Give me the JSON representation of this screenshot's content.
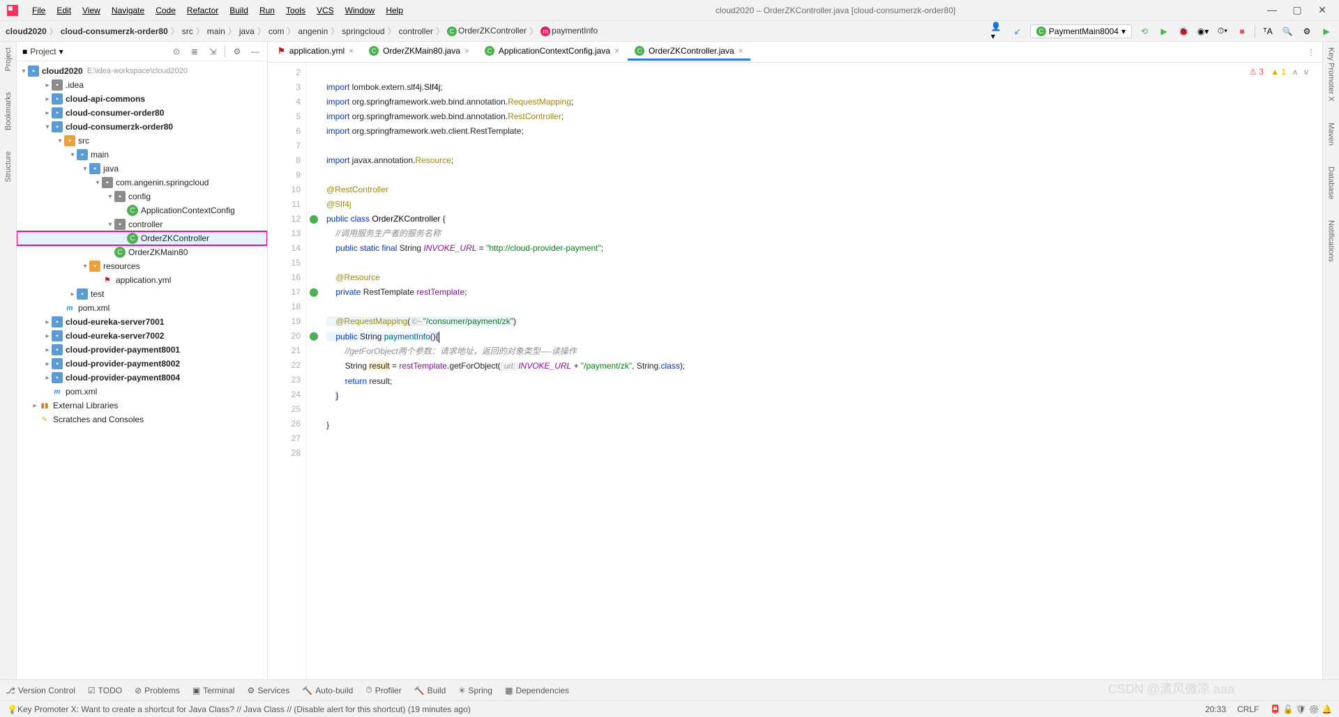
{
  "title": "cloud2020 – OrderZKController.java [cloud-consumerzk-order80]",
  "menu": [
    "File",
    "Edit",
    "View",
    "Navigate",
    "Code",
    "Refactor",
    "Build",
    "Run",
    "Tools",
    "VCS",
    "Window",
    "Help"
  ],
  "breadcrumb": {
    "parts": [
      "cloud2020",
      "cloud-consumerzk-order80",
      "src",
      "main",
      "java",
      "com",
      "angenin",
      "springcloud",
      "controller",
      "OrderZKController",
      "paymentInfo"
    ]
  },
  "run_config": "PaymentMain8004",
  "project_panel": {
    "title": "Project"
  },
  "tree": {
    "root": {
      "name": "cloud2020",
      "path": "E:\\idea-workspace\\cloud2020"
    },
    "items": [
      {
        "indent": 1,
        "name": ".idea",
        "type": "folder"
      },
      {
        "indent": 1,
        "name": "cloud-api-commons",
        "type": "folder-blue",
        "bold": true
      },
      {
        "indent": 1,
        "name": "cloud-consumer-order80",
        "type": "folder-blue",
        "bold": true
      },
      {
        "indent": 1,
        "name": "cloud-consumerzk-order80",
        "type": "folder-blue",
        "bold": true,
        "open": true
      },
      {
        "indent": 2,
        "name": "src",
        "type": "folder-src",
        "open": true
      },
      {
        "indent": 3,
        "name": "main",
        "type": "folder-blue",
        "open": true
      },
      {
        "indent": 4,
        "name": "java",
        "type": "folder-blue",
        "open": true
      },
      {
        "indent": 5,
        "name": "com.angenin.springcloud",
        "type": "folder",
        "open": true
      },
      {
        "indent": 6,
        "name": "config",
        "type": "folder",
        "open": true
      },
      {
        "indent": 7,
        "name": "ApplicationContextConfig",
        "type": "java"
      },
      {
        "indent": 6,
        "name": "controller",
        "type": "folder",
        "open": true
      },
      {
        "indent": 7,
        "name": "OrderZKController",
        "type": "java",
        "selected": true
      },
      {
        "indent": 6,
        "name": "OrderZKMain80",
        "type": "java"
      },
      {
        "indent": 4,
        "name": "resources",
        "type": "folder-src",
        "open": true
      },
      {
        "indent": 5,
        "name": "application.yml",
        "type": "yml"
      },
      {
        "indent": 3,
        "name": "test",
        "type": "folder-blue"
      },
      {
        "indent": 2,
        "name": "pom.xml",
        "type": "pom"
      },
      {
        "indent": 1,
        "name": "cloud-eureka-server7001",
        "type": "folder-blue",
        "bold": true
      },
      {
        "indent": 1,
        "name": "cloud-eureka-server7002",
        "type": "folder-blue",
        "bold": true
      },
      {
        "indent": 1,
        "name": "cloud-provider-payment8001",
        "type": "folder-blue",
        "bold": true
      },
      {
        "indent": 1,
        "name": "cloud-provider-payment8002",
        "type": "folder-blue",
        "bold": true
      },
      {
        "indent": 1,
        "name": "cloud-provider-payment8004",
        "type": "folder-blue",
        "bold": true
      },
      {
        "indent": 1,
        "name": "pom.xml",
        "type": "pom"
      },
      {
        "indent": 0,
        "name": "External Libraries",
        "type": "lib"
      },
      {
        "indent": 0,
        "name": "Scratches and Consoles",
        "type": "scratch"
      }
    ]
  },
  "tabs": [
    {
      "name": "application.yml",
      "icon": "yml",
      "active": false
    },
    {
      "name": "OrderZKMain80.java",
      "icon": "java",
      "active": false
    },
    {
      "name": "ApplicationContextConfig.java",
      "icon": "java",
      "active": false
    },
    {
      "name": "OrderZKController.java",
      "icon": "java",
      "active": true
    }
  ],
  "inspection": {
    "errors": "3",
    "warnings": "1"
  },
  "code_lines": {
    "start": 2,
    "end": 28
  },
  "code": {
    "l3": {
      "kw": "import",
      "p1": " lombok.extern.slf4j.",
      "cls": "Slf4j",
      "p2": ";"
    },
    "l4": {
      "kw": "import",
      "p1": " org.springframework.web.bind.annotation.",
      "cls": "RequestMapping",
      "p2": ";"
    },
    "l5": {
      "kw": "import",
      "p1": " org.springframework.web.bind.annotation.",
      "cls": "RestController",
      "p2": ";"
    },
    "l6": {
      "kw": "import",
      "p1": " org.springframework.web.client.RestTemplate;"
    },
    "l8": {
      "kw": "import",
      "p1": " javax.annotation.",
      "cls": "Resource",
      "p2": ";"
    },
    "l10": "@RestController",
    "l11": "@Slf4j",
    "l12": {
      "kw1": "public",
      "kw2": "class",
      "cls": "OrderZKController",
      "brace": " {"
    },
    "l13": "//调用服务生产者的服务名称",
    "l14": {
      "kw": "public static final",
      "type": " String ",
      "name": "INVOKE_URL",
      "eq": " = ",
      "str": "\"http://cloud-provider-payment\"",
      "end": ";"
    },
    "l16": "@Resource",
    "l17": {
      "kw": "private",
      "type": " RestTemplate ",
      "name": "restTemplate",
      "end": ";"
    },
    "l19": {
      "anno": "@RequestMapping",
      "open": "(",
      "hint": "©~",
      "str": "\"/consumer/payment/zk\"",
      "close": ")"
    },
    "l20": {
      "kw": "public",
      "type": " String ",
      "name": "paymentInfo",
      "paren": "()",
      "brace": "{"
    },
    "l21": "//getForObject两个参数：请求地址，返回的对象类型----读操作",
    "l22": {
      "type": "String ",
      "var": "result",
      "eq": " = ",
      "obj": "restTemplate",
      "call": ".getForObject(",
      "hint": " url: ",
      "const": "INVOKE_URL",
      "plus": " + ",
      "str": "\"/payment/zk\"",
      "rest": ", String.",
      "kw": "class",
      "end": ");"
    },
    "l23": {
      "kw": "return",
      "var": " result",
      "end": ";"
    },
    "l24": "}",
    "l26": "}"
  },
  "bottom_tools": [
    {
      "icon": "vcs",
      "label": "Version Control"
    },
    {
      "icon": "todo",
      "label": "TODO"
    },
    {
      "icon": "problems",
      "label": "Problems"
    },
    {
      "icon": "terminal",
      "label": "Terminal"
    },
    {
      "icon": "services",
      "label": "Services"
    },
    {
      "icon": "autobuild",
      "label": "Auto-build"
    },
    {
      "icon": "profiler",
      "label": "Profiler"
    },
    {
      "icon": "build",
      "label": "Build"
    },
    {
      "icon": "spring",
      "label": "Spring"
    },
    {
      "icon": "deps",
      "label": "Dependencies"
    }
  ],
  "status": {
    "msg": "Key Promoter X: Want to create a shortcut for Java Class? // Java Class // (Disable alert for this shortcut) (19 minutes ago)",
    "pos": "20:33",
    "enc": "CRLF",
    "watermark": "CSDN @清风微凉 aaa"
  },
  "left_tabs": [
    "Project",
    "Bookmarks",
    "Structure"
  ],
  "right_tabs": [
    "Key Promoter X",
    "Maven",
    "Database",
    "Notifications"
  ]
}
